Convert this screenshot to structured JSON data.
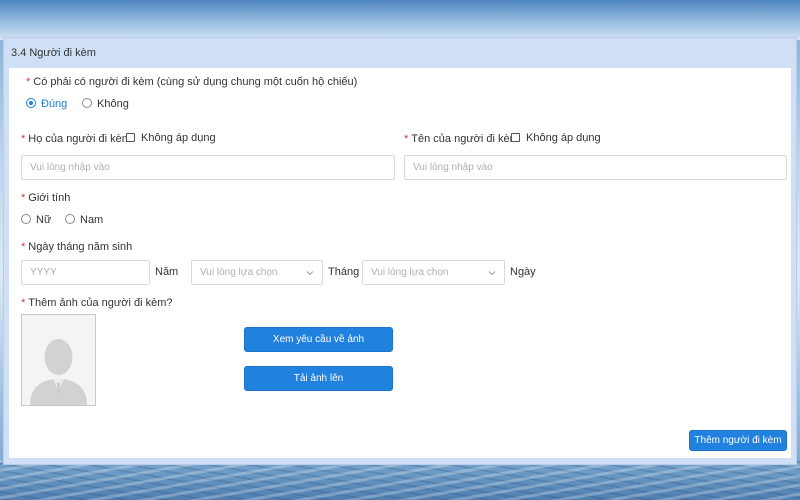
{
  "section": {
    "title": "3.4 Người đi kèm"
  },
  "companion_question": {
    "label": "Có phải có người đi kèm (cùng sử dụng chung một cuốn hộ chiếu)",
    "options": [
      {
        "label": "Đúng",
        "selected": true
      },
      {
        "label": "Không",
        "selected": false
      }
    ]
  },
  "last_name": {
    "label": "Họ của người đi kèm",
    "not_applicable_label": "Không áp dụng",
    "placeholder": "Vui lòng nhập vào",
    "value": ""
  },
  "first_name": {
    "label": "Tên của người đi kèm",
    "not_applicable_label": "Không áp dụng",
    "placeholder": "Vui lòng nhập vào",
    "value": ""
  },
  "gender": {
    "label": "Giới tính",
    "options": [
      {
        "label": "Nữ",
        "selected": false
      },
      {
        "label": "Nam",
        "selected": false
      }
    ]
  },
  "birth_date": {
    "label": "Ngày tháng năm sinh",
    "year_placeholder": "YYYY",
    "year_unit": "Năm",
    "month_placeholder": "Vui lòng lựa chọn",
    "month_unit": "Tháng",
    "day_placeholder": "Vui lòng lựa chọn",
    "day_unit": "Ngày"
  },
  "photo": {
    "label": "Thêm ảnh của người đi kèm?",
    "requirements_button": "Xem yêu cầu về ảnh",
    "upload_button": "Tải ảnh lên"
  },
  "add_companion_button": "Thêm người đi kèm",
  "colors": {
    "accent": "#2181de",
    "required": "#e0353d",
    "panel_header": "#cfe0f6"
  }
}
